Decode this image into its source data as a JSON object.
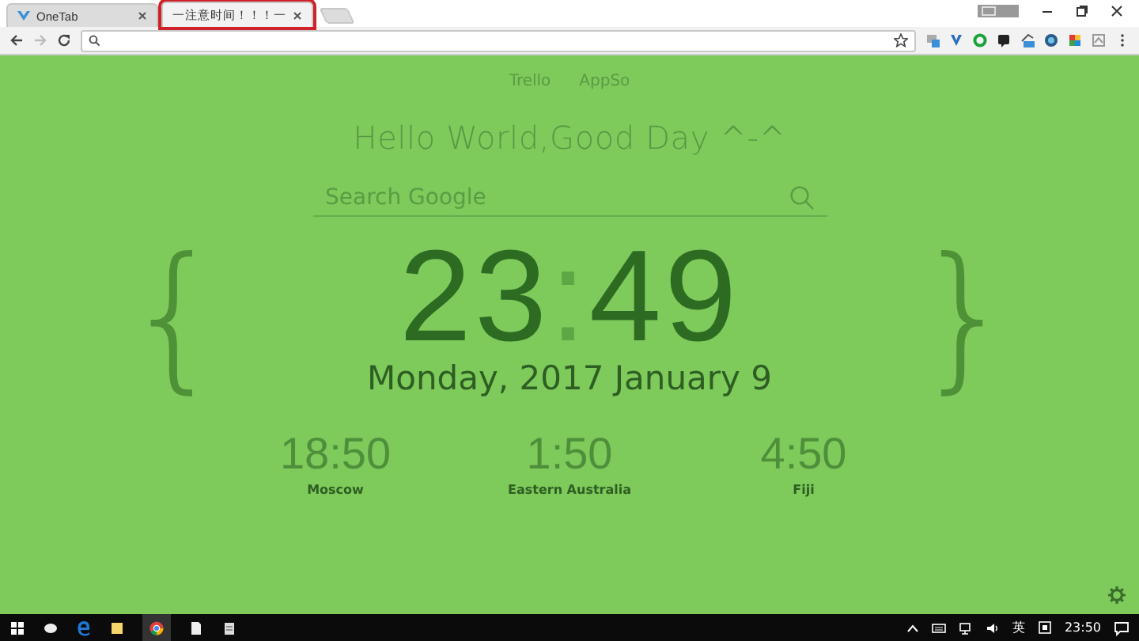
{
  "browser": {
    "tabs": [
      {
        "title": "OneTab",
        "selected": false,
        "highlighted": false
      },
      {
        "title": "一注意时间！！！一",
        "selected": true,
        "highlighted": true
      }
    ]
  },
  "page": {
    "links": [
      "Trello",
      "AppSo"
    ],
    "greeting": "Hello World,Good Day ^-^",
    "search": {
      "placeholder": "Search Google"
    },
    "open_brace": "{",
    "close_brace": "}",
    "clock": {
      "hours": "23",
      "separator": ":",
      "minutes": "49"
    },
    "date": "Monday, 2017 January 9",
    "world_clocks": [
      {
        "time": "18:50",
        "city": "Moscow"
      },
      {
        "time": "1:50",
        "city": "Eastern Australia"
      },
      {
        "time": "4:50",
        "city": "Fiji"
      }
    ]
  },
  "taskbar": {
    "ime": "英",
    "time": "23:50"
  }
}
